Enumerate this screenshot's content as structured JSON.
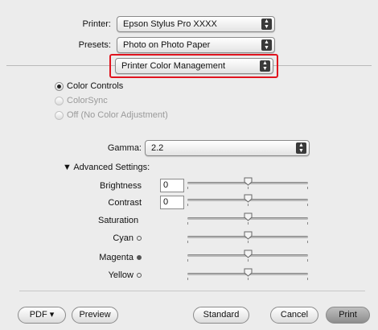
{
  "printer": {
    "label": "Printer:",
    "value": "Epson Stylus Pro XXXX"
  },
  "presets": {
    "label": "Presets:",
    "value": "Photo on Photo Paper"
  },
  "panel": {
    "value": "Printer Color Management"
  },
  "color_mode": {
    "options": [
      {
        "label": "Color Controls",
        "selected": true,
        "enabled": true
      },
      {
        "label": "ColorSync",
        "selected": false,
        "enabled": false
      },
      {
        "label": "Off (No Color Adjustment)",
        "selected": false,
        "enabled": false
      }
    ]
  },
  "gamma": {
    "label": "Gamma:",
    "value": "2.2"
  },
  "advanced": {
    "toggle_label": "▼ Advanced Settings:",
    "rows": [
      {
        "label": "Brightness",
        "value": "0",
        "level": 0.5
      },
      {
        "label": "Contrast",
        "value": "0",
        "level": 0.5
      },
      {
        "label": "Saturation",
        "level": 0.5
      },
      {
        "label": "Cyan",
        "level": 0.5
      },
      {
        "label": "Magenta",
        "level": 0.5
      },
      {
        "label": "Yellow",
        "level": 0.5
      }
    ]
  },
  "footer": {
    "pdf_label": "PDF ▾",
    "preview_label": "Preview",
    "standard_label": "Standard",
    "cancel_label": "Cancel",
    "print_label": "Print"
  },
  "colors": {
    "highlight": "#e0141e"
  }
}
